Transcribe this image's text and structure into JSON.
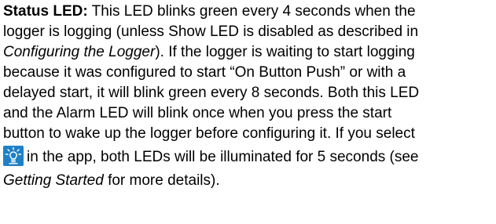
{
  "section": {
    "term": "Status LED:",
    "lines": [
      {
        "text": " This LED blinks green every 4 seconds when the"
      },
      {
        "text": "logger is logging (unless Show LED is disabled as described in"
      },
      {
        "pre": "",
        "ref": "Configuring the Logger",
        "post": "). If the logger is waiting to start logging"
      },
      {
        "text": "because it was configured to start “On Button Push” or with a"
      },
      {
        "text": "delayed start, it will blink green every 8 seconds. Both this LED"
      },
      {
        "text": "and the Alarm LED will blink once when you press the start"
      },
      {
        "text": "button to wake up the logger before configuring it. If you select"
      },
      {
        "text": "in the app, both LEDs will be illuminated for 5 seconds (see"
      },
      {
        "pre": "",
        "ref": "Getting Started",
        "post": " for more details)."
      }
    ]
  },
  "icons": {
    "led_icon": "light-bulb-icon",
    "led_icon_bg": "#1f80c8",
    "led_icon_fg": "#ffffff"
  }
}
